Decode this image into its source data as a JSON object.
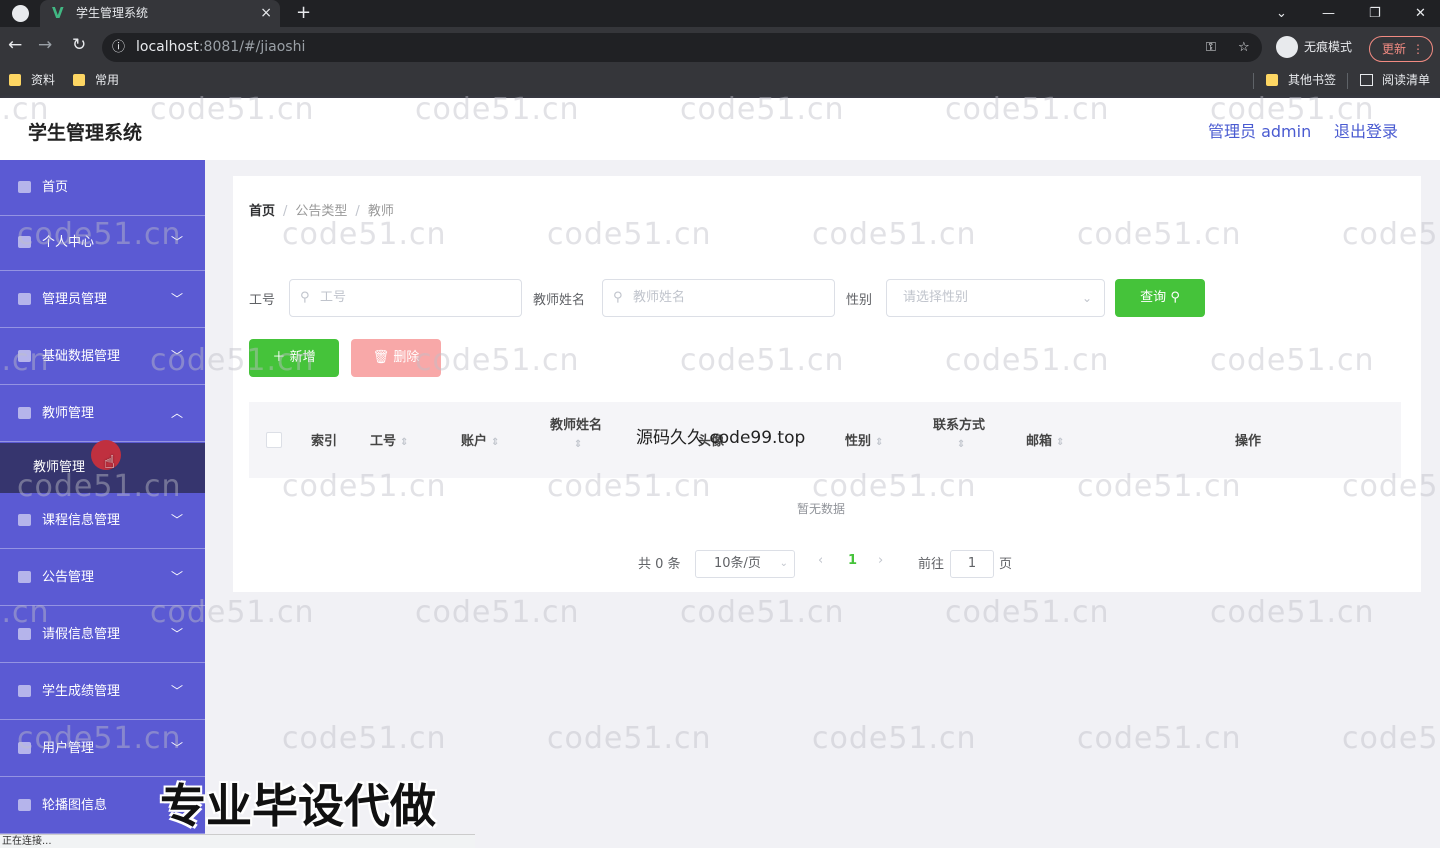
{
  "browser": {
    "tab_title": "学生管理系统",
    "tab_close": "×",
    "new_tab": "+",
    "url_host": "localhost",
    "url_rest": ":8081/#/jiaoshi",
    "incognito_label": "无痕模式",
    "update_label": "更新",
    "bookmarks": [
      "资料",
      "常用"
    ],
    "other_bookmarks": "其他书签",
    "reading_list": "阅读清单",
    "status_text": "正在连接..."
  },
  "header": {
    "title": "学生管理系统",
    "user": "管理员 admin",
    "logout": "退出登录"
  },
  "sidebar": {
    "items": [
      {
        "label": "首页",
        "icon": "home-icon",
        "expandable": false
      },
      {
        "label": "个人中心",
        "icon": "user-icon",
        "expandable": true
      },
      {
        "label": "管理员管理",
        "icon": "admin-icon",
        "expandable": true
      },
      {
        "label": "基础数据管理",
        "icon": "data-icon",
        "expandable": true
      },
      {
        "label": "教师管理",
        "icon": "teacher-icon",
        "expandable": true,
        "expanded": true
      },
      {
        "label": "课程信息管理",
        "icon": "course-icon",
        "expandable": true
      },
      {
        "label": "公告管理",
        "icon": "notice-icon",
        "expandable": true
      },
      {
        "label": "请假信息管理",
        "icon": "leave-icon",
        "expandable": true
      },
      {
        "label": "学生成绩管理",
        "icon": "score-icon",
        "expandable": true
      },
      {
        "label": "用户管理",
        "icon": "users-icon",
        "expandable": true
      },
      {
        "label": "轮播图信息",
        "icon": "carousel-icon",
        "expandable": false
      }
    ],
    "active_sub": "教师管理"
  },
  "breadcrumb": [
    "首页",
    "公告类型",
    "教师"
  ],
  "search": {
    "gonghao_label": "工号",
    "gonghao_placeholder": "工号",
    "name_label": "教师姓名",
    "name_placeholder": "教师姓名",
    "sex_label": "性别",
    "sex_placeholder": "请选择性别",
    "query_button": "查询"
  },
  "actions": {
    "add_button": "新增",
    "delete_button": "删除"
  },
  "table": {
    "columns": [
      "索引",
      "工号",
      "账户",
      "教师姓名",
      "头像",
      "性别",
      "联系方式",
      "邮箱",
      "操作"
    ],
    "empty_text": "暂无数据"
  },
  "pagination": {
    "total": "共 0 条",
    "page_size": "10条/页",
    "current_page": "1",
    "goto_label": "前往",
    "goto_value": "1",
    "page_suffix": "页"
  },
  "overlays": {
    "source_text": "源码久久 code99.top",
    "ad_text": "专业毕设代做",
    "watermark": "code51.cn"
  },
  "colors": {
    "sidebar": "#5b5ad3",
    "sidebar_active": "#36356e",
    "primary_green": "#45c33a",
    "danger_light": "#f8a8a8",
    "header_link": "#4a5bd1"
  }
}
